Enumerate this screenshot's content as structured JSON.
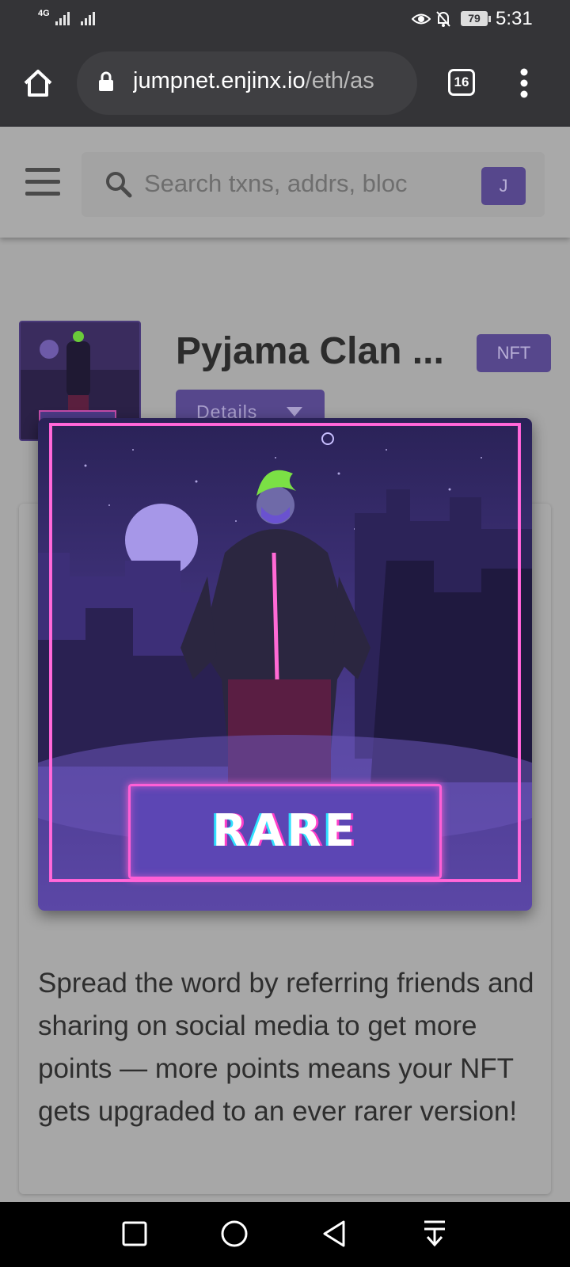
{
  "status_bar": {
    "network": "4G",
    "battery": "79",
    "time": "5:31"
  },
  "browser": {
    "url_host": "jumpnet.enjinx.io",
    "url_path": "/eth/as",
    "tab_count": "16"
  },
  "site_header": {
    "search_placeholder": "Search txns, addrs, bloc",
    "network_button": "J"
  },
  "asset": {
    "title": "Pyjama Clan ...",
    "type_badge": "NFT",
    "details_button": "Details",
    "description": "Spread the word by referring friends and sharing on social media to get more points — more points means your NFT gets upgraded to an ever rarer version!"
  },
  "popup": {
    "rarity_label": "RARE"
  }
}
